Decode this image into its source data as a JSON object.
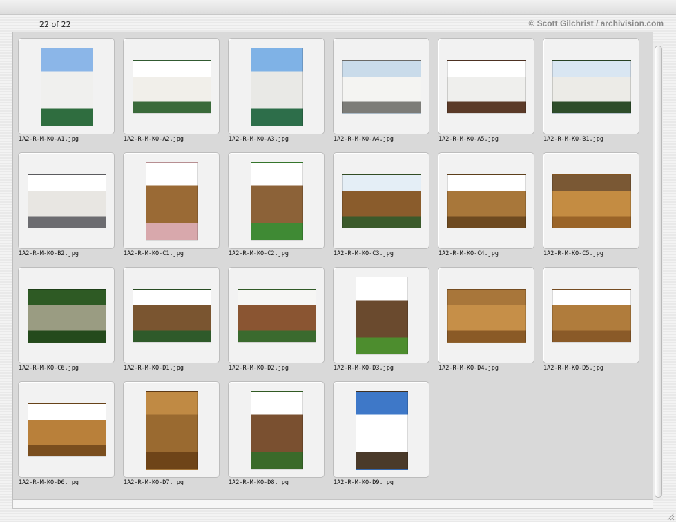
{
  "header": {
    "counter": "22 of 22",
    "credit": "© Scott Gilchrist / archivision.com"
  },
  "items": [
    {
      "filename": "1A2-R-M-KO-A1.jpg",
      "orientation": "portrait",
      "colors": [
        "#8bb6e8",
        "#f0f0ee",
        "#2f6d3f"
      ]
    },
    {
      "filename": "1A2-R-M-KO-A2.jpg",
      "orientation": "landscape",
      "colors": [
        "#ffffff",
        "#f1efea",
        "#3a6a3a"
      ]
    },
    {
      "filename": "1A2-R-M-KO-A3.jpg",
      "orientation": "portrait",
      "colors": [
        "#7fb2e6",
        "#e9e9e6",
        "#2d6e4a"
      ]
    },
    {
      "filename": "1A2-R-M-KO-A4.jpg",
      "orientation": "landscape",
      "colors": [
        "#c9dbea",
        "#f4f4f2",
        "#7c7c78"
      ]
    },
    {
      "filename": "1A2-R-M-KO-A5.jpg",
      "orientation": "landscape",
      "colors": [
        "#ffffff",
        "#efefed",
        "#5b3a28"
      ]
    },
    {
      "filename": "1A2-R-M-KO-B1.jpg",
      "orientation": "landscape",
      "colors": [
        "#d9e6f2",
        "#ecebe7",
        "#2e4d2a"
      ]
    },
    {
      "filename": "1A2-R-M-KO-B2.jpg",
      "orientation": "landscape",
      "colors": [
        "#ffffff",
        "#e8e6e2",
        "#6c6c70"
      ]
    },
    {
      "filename": "1A2-R-M-KO-C1.jpg",
      "orientation": "portrait",
      "colors": [
        "#ffffff",
        "#9a6a35",
        "#d8a8ac"
      ]
    },
    {
      "filename": "1A2-R-M-KO-C2.jpg",
      "orientation": "portrait",
      "colors": [
        "#ffffff",
        "#8c6238",
        "#3f8a34"
      ]
    },
    {
      "filename": "1A2-R-M-KO-C3.jpg",
      "orientation": "landscape",
      "colors": [
        "#e4eef6",
        "#8a5c2c",
        "#3b5a2b"
      ]
    },
    {
      "filename": "1A2-R-M-KO-C4.jpg",
      "orientation": "landscape",
      "colors": [
        "#ffffff",
        "#a8773a",
        "#6e4a20"
      ]
    },
    {
      "filename": "1A2-R-M-KO-C5.jpg",
      "orientation": "landscape",
      "colors": [
        "#7a5834",
        "#c48c42",
        "#9a6428"
      ]
    },
    {
      "filename": "1A2-R-M-KO-C6.jpg",
      "orientation": "landscape",
      "colors": [
        "#2e5a24",
        "#9a9c82",
        "#244a1c"
      ]
    },
    {
      "filename": "1A2-R-M-KO-D1.jpg",
      "orientation": "landscape",
      "colors": [
        "#ffffff",
        "#7a5530",
        "#2f5a2a"
      ]
    },
    {
      "filename": "1A2-R-M-KO-D2.jpg",
      "orientation": "landscape",
      "colors": [
        "#f6f6f4",
        "#8a5532",
        "#3a6a2e"
      ]
    },
    {
      "filename": "1A2-R-M-KO-D3.jpg",
      "orientation": "portrait",
      "colors": [
        "#ffffff",
        "#6a4a2e",
        "#4d8d2e"
      ]
    },
    {
      "filename": "1A2-R-M-KO-D4.jpg",
      "orientation": "landscape",
      "colors": [
        "#a8763a",
        "#c68f48",
        "#8a5a26"
      ]
    },
    {
      "filename": "1A2-R-M-KO-D5.jpg",
      "orientation": "landscape",
      "colors": [
        "#ffffff",
        "#b07c3c",
        "#8a5a28"
      ]
    },
    {
      "filename": "1A2-R-M-KO-D6.jpg",
      "orientation": "landscape",
      "colors": [
        "#ffffff",
        "#b9803a",
        "#7a4e1e"
      ]
    },
    {
      "filename": "1A2-R-M-KO-D7.jpg",
      "orientation": "portrait",
      "colors": [
        "#c08a44",
        "#9a6a30",
        "#6e4418"
      ]
    },
    {
      "filename": "1A2-R-M-KO-D8.jpg",
      "orientation": "portrait",
      "colors": [
        "#ffffff",
        "#7a5030",
        "#3a6a2a"
      ]
    },
    {
      "filename": "1A2-R-M-KO-D9.jpg",
      "orientation": "portrait",
      "colors": [
        "#3e78c8",
        "#ffffff",
        "#4a3a2a"
      ]
    }
  ]
}
